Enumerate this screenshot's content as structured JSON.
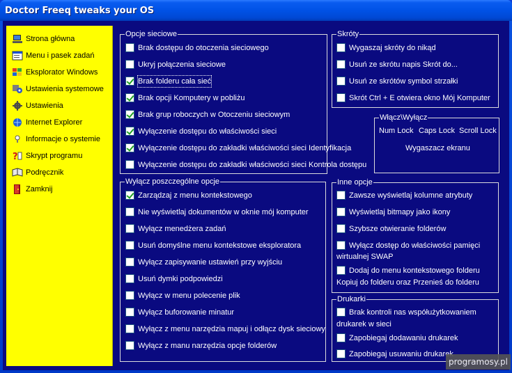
{
  "window": {
    "title": "Doctor Freeq tweaks your OS"
  },
  "sidebar": {
    "items": [
      {
        "label": "Strona główna",
        "icon": "monitor-icon"
      },
      {
        "label": "Menu i pasek zadań",
        "icon": "menu-window-icon"
      },
      {
        "label": "Eksplorator Windows",
        "icon": "windows-flag-icon"
      },
      {
        "label": "Ustawienia systemowe",
        "icon": "system-settings-icon"
      },
      {
        "label": "Ustawienia",
        "icon": "gear-icon"
      },
      {
        "label": "Internet Explorer",
        "icon": "globe-icon"
      },
      {
        "label": "Informacje o systemie",
        "icon": "lightbulb-icon"
      },
      {
        "label": "Skrypt programu",
        "icon": "question-icon"
      },
      {
        "label": "Podręcznik",
        "icon": "book-icon"
      },
      {
        "label": "Zamknij",
        "icon": "exit-door-icon"
      }
    ]
  },
  "network": {
    "title": "Opcje sieciowe",
    "options": [
      {
        "label": "Brak dostępu do otoczenia sieciowego",
        "checked": false
      },
      {
        "label": "Ukryj połączenia sieciowe",
        "checked": false
      },
      {
        "label": "Brak folderu cała sieć",
        "checked": true
      },
      {
        "label": "Brak opcji Komputery w pobliżu",
        "checked": true
      },
      {
        "label": "Brak grup roboczych w Otoczeniu sieciowym",
        "checked": true
      },
      {
        "label": "Wyłączenie dostępu do właściwości sieci",
        "checked": true
      },
      {
        "label": "Wyłączenie dostępu do zakładki właściwości sieci Identyfikacja",
        "checked": true
      },
      {
        "label": "Wyłączenie dostępu do zakładki właściwości sieci Kontrola dostępu",
        "checked": false
      }
    ]
  },
  "shortcuts": {
    "title": "Skróty",
    "options": [
      {
        "label": "Wygaszaj skróty do nikąd",
        "checked": false
      },
      {
        "label": "Usuń ze skrótu napis Skrót do...",
        "checked": false
      },
      {
        "label": "Usuń ze skrótów symbol strzałki",
        "checked": false
      },
      {
        "label": "Skrót Ctrl + E otwiera okno Mój Komputer",
        "checked": false
      }
    ]
  },
  "toggles": {
    "title": "Włącz\\Wyłącz",
    "num_lock": "Num Lock",
    "caps_lock": "Caps Lock",
    "scroll_lock": "Scroll Lock",
    "screensaver": "Wygaszacz ekranu"
  },
  "individual": {
    "title": "Wyłącz poszczególne opcje",
    "options": [
      {
        "label": "Zarządzaj z menu  kontekstowego",
        "checked": true
      },
      {
        "label": "Nie wyświetlaj dokumentów w oknie mój komputer",
        "checked": false
      },
      {
        "label": "Wyłącz menedżera zadań",
        "checked": false
      },
      {
        "label": "Usuń domyślne menu kontekstowe eksploratora",
        "checked": false
      },
      {
        "label": "Wyłącz zapisywanie ustawień przy wyjściu",
        "checked": false
      },
      {
        "label": "Usuń dymki podpowiedzi",
        "checked": false
      },
      {
        "label": "Wyłącz w menu polecenie plik",
        "checked": false
      },
      {
        "label": "Wyłącz buforowanie minatur",
        "checked": false
      },
      {
        "label": "Wyłącz z menu narzędzia mapuj i odłącz dysk sieciowy",
        "checked": false
      },
      {
        "label": "Wyłącz z manu narzędzia opcje folderów",
        "checked": false
      }
    ]
  },
  "other": {
    "title": "Inne opcje",
    "options": [
      {
        "label": "Zawsze wyświetlaj kolumne atrybuty",
        "checked": false
      },
      {
        "label": "Wyświetlaj bitmapy jako ikony",
        "checked": false
      },
      {
        "label": "Szybsze otwieranie folderów",
        "checked": false
      },
      {
        "label": "Wyłącz dostęp do właściwości pamięci",
        "label2": "wirtualnej SWAP",
        "checked": false
      },
      {
        "label": "Dodaj do menu kontekstowego folderu",
        "label2": "Kopiuj do folderu oraz Przenieś do folderu",
        "checked": false
      }
    ]
  },
  "printers": {
    "title": "Drukarki",
    "options": [
      {
        "label": "Brak kontroli nas współużytkowaniem",
        "label2": "drukarek w sieci",
        "checked": false
      },
      {
        "label": "Zapobiegaj dodawaniu drukarek",
        "checked": false
      },
      {
        "label": "Zapobiegaj usuwaniu drukarek",
        "checked": false
      }
    ]
  },
  "watermark": "programosy.pl"
}
